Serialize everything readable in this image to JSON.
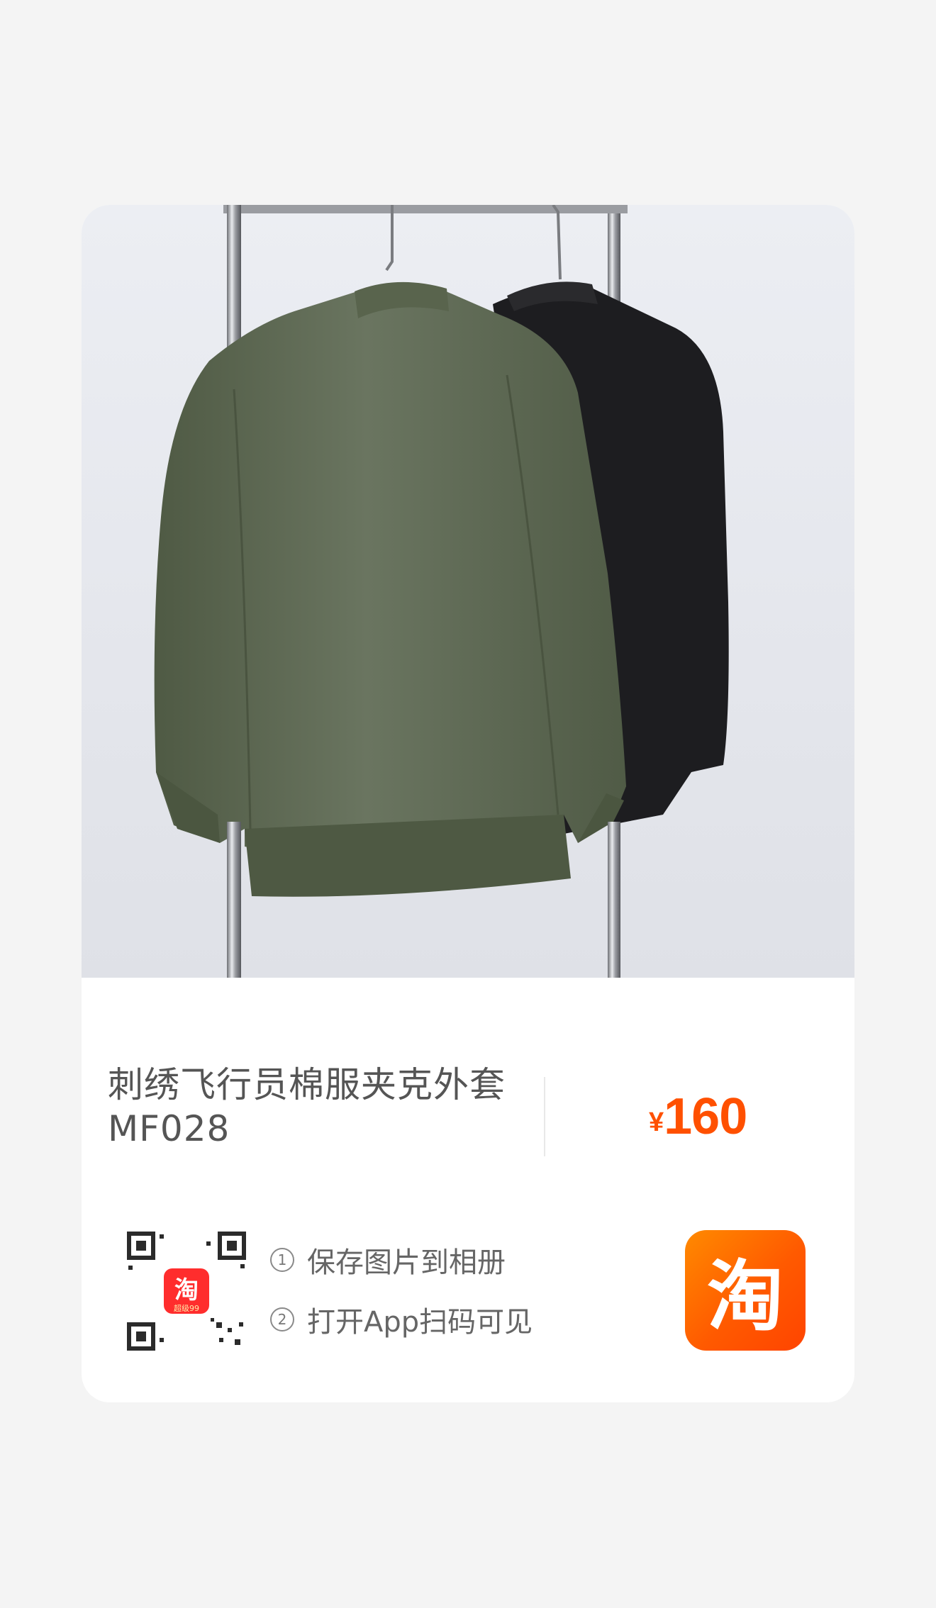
{
  "product": {
    "title_line1": "刺绣飞行员棉服夹克外套",
    "title_line2": "MF028",
    "currency": "¥",
    "price": "160"
  },
  "instructions": {
    "step1_num": "1",
    "step1_text": "保存图片到相册",
    "step2_num": "2",
    "step2_text": "打开App扫码可见"
  },
  "qr_badge": {
    "glyph": "淘",
    "caption": "超级99"
  },
  "logo": {
    "glyph": "淘"
  },
  "colors": {
    "accent": "#ff5000",
    "logo_bg": "#ff6a00",
    "jacket_green": "#5f6b52",
    "jacket_black": "#1c1c1e"
  },
  "icons": [
    "qr-code-icon",
    "taobao-logo-icon"
  ]
}
